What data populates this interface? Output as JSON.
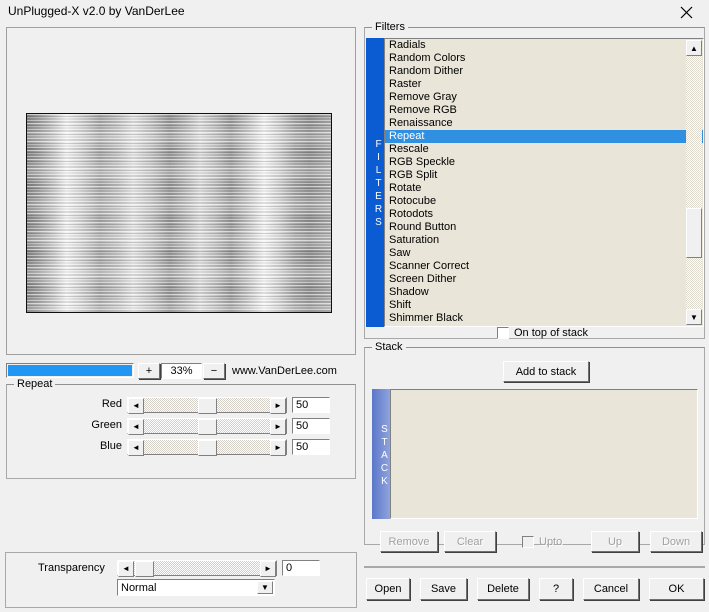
{
  "window": {
    "title": "UnPlugged-X v2.0 by VanDerLee",
    "close_label": "close-icon"
  },
  "preview": {
    "caption": ""
  },
  "zoom": {
    "plus_label": "+",
    "value": "33%",
    "minus_label": "−",
    "fill_percent": 100,
    "website": "www.VanDerLee.com"
  },
  "repeat": {
    "legend": "Repeat",
    "sliders": [
      {
        "label": "Red",
        "value": "50",
        "left_arrow": "◄",
        "right_arrow": "►"
      },
      {
        "label": "Green",
        "value": "50",
        "left_arrow": "◄",
        "right_arrow": "►"
      },
      {
        "label": "Blue",
        "value": "50",
        "left_arrow": "◄",
        "right_arrow": "►"
      }
    ]
  },
  "transparency": {
    "label": "Transparency",
    "value": "0",
    "left_arrow": "◄",
    "right_arrow": "►",
    "blend_mode": "Normal",
    "blend_arrow": "▼"
  },
  "filters": {
    "legend": "Filters",
    "band_label": "FILTERS",
    "selected": "Repeat",
    "items": [
      "Radials",
      "Random Colors",
      "Random Dither",
      "Raster",
      "Remove Gray",
      "Remove RGB",
      "Renaissance",
      "Repeat",
      "Rescale",
      "RGB Speckle",
      "RGB Split",
      "Rotate",
      "Rotocube",
      "Rotodots",
      "Round Button",
      "Saturation",
      "Saw",
      "Scanner Correct",
      "Screen Dither",
      "Shadow",
      "Shift",
      "Shimmer Black"
    ],
    "scroll_up_arrow": "▲",
    "scroll_down_arrow": "▼",
    "on_top_of_stack": {
      "label": "On top of stack",
      "checked": false
    }
  },
  "stack": {
    "legend": "Stack",
    "band_label": "STACK",
    "add_button": "Add to stack",
    "items": [],
    "controls": {
      "remove": "Remove",
      "clear": "Clear",
      "upto": "Upto",
      "upto_checked": false,
      "up": "Up",
      "down": "Down"
    }
  },
  "dialog_buttons": {
    "open": "Open",
    "save": "Save",
    "delete": "Delete",
    "help": "?",
    "cancel": "Cancel",
    "ok": "OK"
  },
  "colors": {
    "window_bg": "#f0f0f0",
    "list_bg": "#e9e5d8",
    "selection_blue": "#2f8fe0",
    "band_blue": "#0b5bd3",
    "stack_band_blue": "#5b77c8",
    "zoom_fill": "#2196f3"
  }
}
